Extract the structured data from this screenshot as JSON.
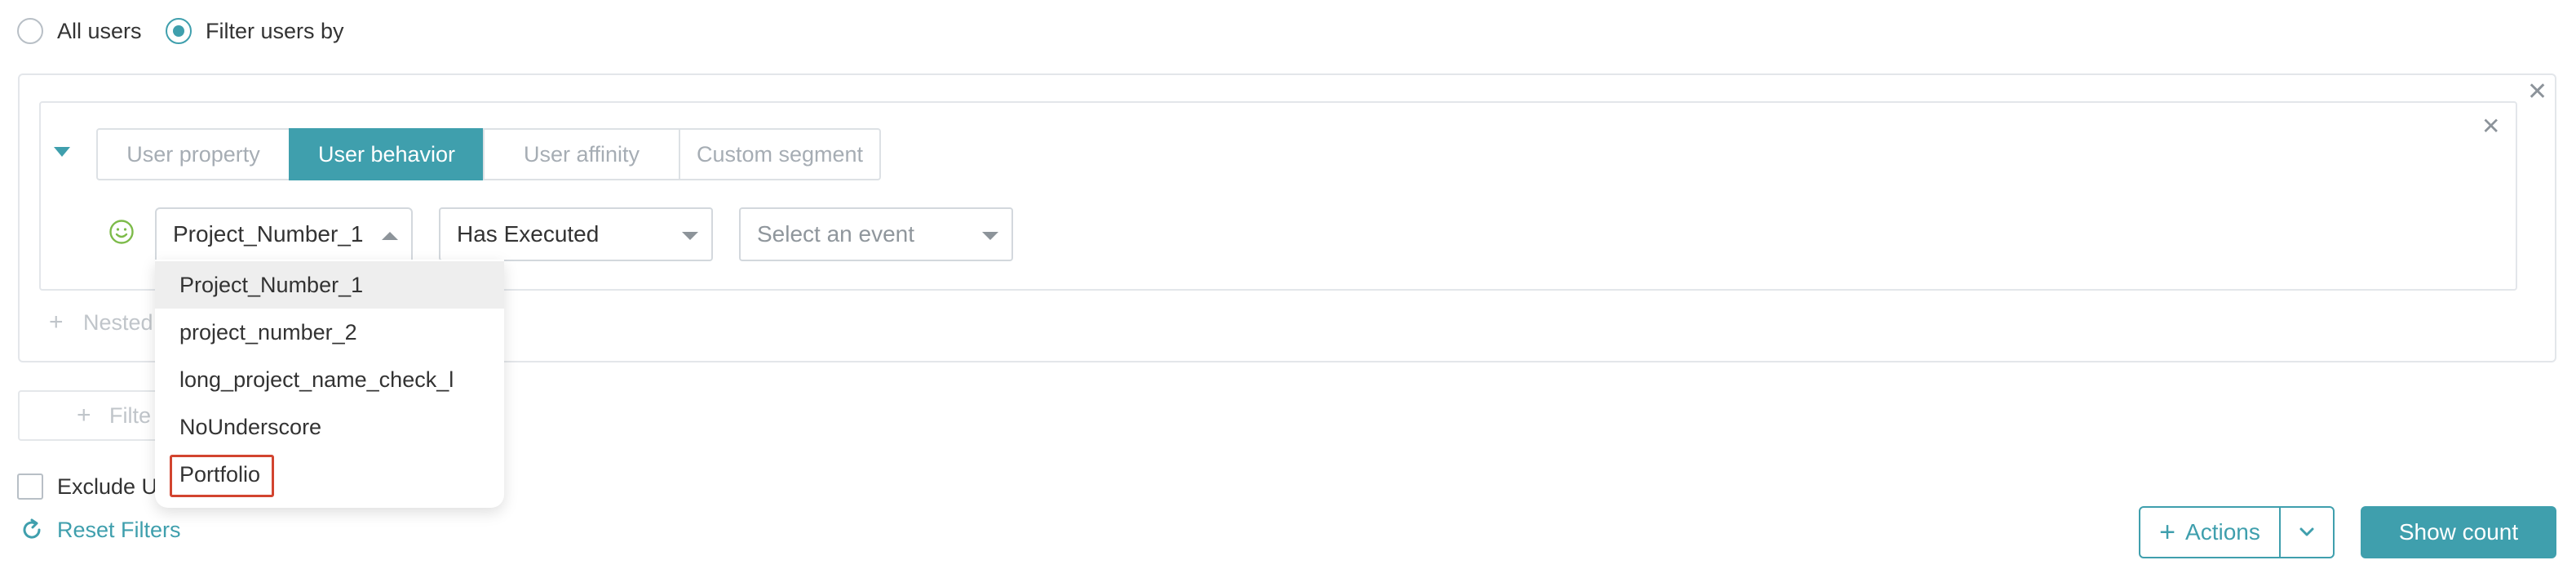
{
  "audience": {
    "all_users_label": "All users",
    "filter_users_label": "Filter users by"
  },
  "tabs": [
    {
      "label": "User property",
      "active": false
    },
    {
      "label": "User behavior",
      "active": true
    },
    {
      "label": "User affinity",
      "active": false
    },
    {
      "label": "Custom segment",
      "active": false
    }
  ],
  "filter_row": {
    "user_icon": "smiley-icon",
    "project_select": {
      "value": "Project_Number_1"
    },
    "behavior_select": {
      "value": "Has Executed"
    },
    "event_select": {
      "placeholder": "Select an event"
    }
  },
  "project_dropdown": {
    "options": [
      "Project_Number_1",
      "project_number_2",
      "long_project_name_check_l",
      "NoUnderscore",
      "Portfolio"
    ]
  },
  "nested_filter": {
    "label": "Nested"
  },
  "add_filter": {
    "label": "Filte"
  },
  "exclude": {
    "label": "Exclude U"
  },
  "reset_filters": {
    "label": "Reset Filters"
  },
  "actions_button": {
    "label": "Actions"
  },
  "show_count_button": {
    "label": "Show count"
  },
  "colors": {
    "accent": "#3f9fad",
    "highlight_border": "#d2442f",
    "smiley": "#7dbb4a"
  }
}
